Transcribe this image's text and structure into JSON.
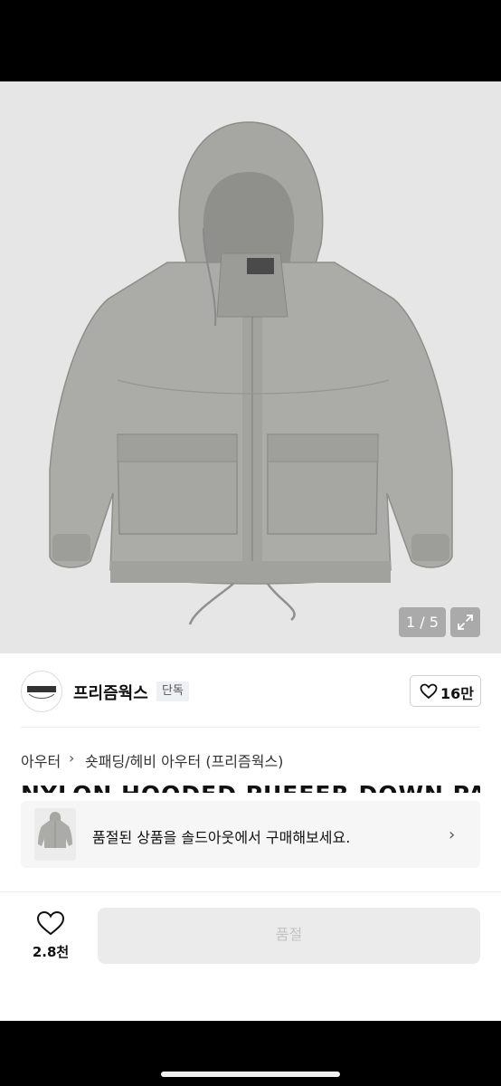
{
  "gallery": {
    "counter": "1 / 5"
  },
  "seller": {
    "name": "프리즘웍스",
    "badge": "단독",
    "likes": "16만"
  },
  "breadcrumb": {
    "category": "아우터",
    "subcategory": "숏패딩/헤비 아우터 (프리즘웍스)"
  },
  "product": {
    "title": "NYLON HOODED PUFFER DOWN PARKA - G"
  },
  "soldout_banner": {
    "text": "품절된 상품을 솔드아웃에서 구매해보세요."
  },
  "bottom_bar": {
    "wish_count": "2.8천",
    "buy_label": "품절"
  },
  "icons": [
    "heart-icon",
    "expand-icon",
    "chevron-right-icon"
  ],
  "colors": {
    "product": "#a9aaa5",
    "disabled_button": "#ebebeb",
    "disabled_text": "#c3c3c3"
  }
}
